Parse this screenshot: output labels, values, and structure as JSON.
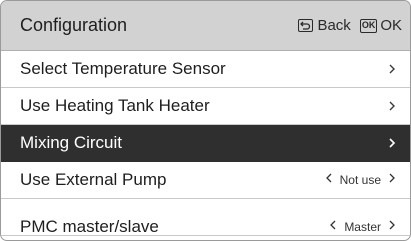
{
  "header": {
    "title": "Configuration",
    "back_label": "Back",
    "ok_key": "OK",
    "ok_label": "OK"
  },
  "menu": {
    "items": [
      {
        "label": "Select Temperature Sensor",
        "value": "",
        "selected": false
      },
      {
        "label": "Use Heating Tank Heater",
        "value": "",
        "selected": false
      },
      {
        "label": "Mixing Circuit",
        "value": "",
        "selected": true
      },
      {
        "label": "Use External Pump",
        "value": "Not use",
        "selected": false
      },
      {
        "label": "PMC master/slave",
        "value": "Master",
        "selected": false
      }
    ]
  },
  "icons": {
    "back": "back-arrow-icon",
    "ok": "ok-key-icon",
    "next": "chevron-right-icon",
    "prev": "chevron-left-icon"
  }
}
